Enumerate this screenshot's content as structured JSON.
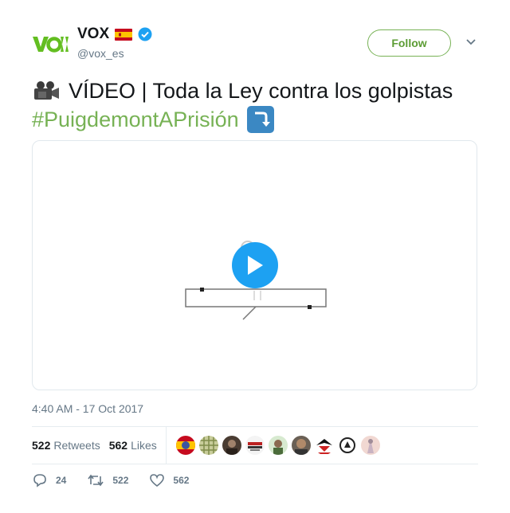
{
  "account": {
    "display_name": "VOX",
    "handle": "@vox_es",
    "brand_color": "#77b255"
  },
  "follow_label": "Follow",
  "tweet": {
    "label": "VÍDEO | Toda la Ley contra los golpistas",
    "hashtag": "#PuigdemontAPrisión"
  },
  "timestamp": "4:40 AM - 17 Oct 2017",
  "stats": {
    "retweets_count": "522",
    "retweets_label": "Retweets",
    "likes_count": "562",
    "likes_label": "Likes"
  },
  "actions": {
    "replies": "24",
    "retweets": "522",
    "likes": "562"
  },
  "colors": {
    "link": "#77b255",
    "play": "#1da1f2",
    "muted": "#657786"
  }
}
